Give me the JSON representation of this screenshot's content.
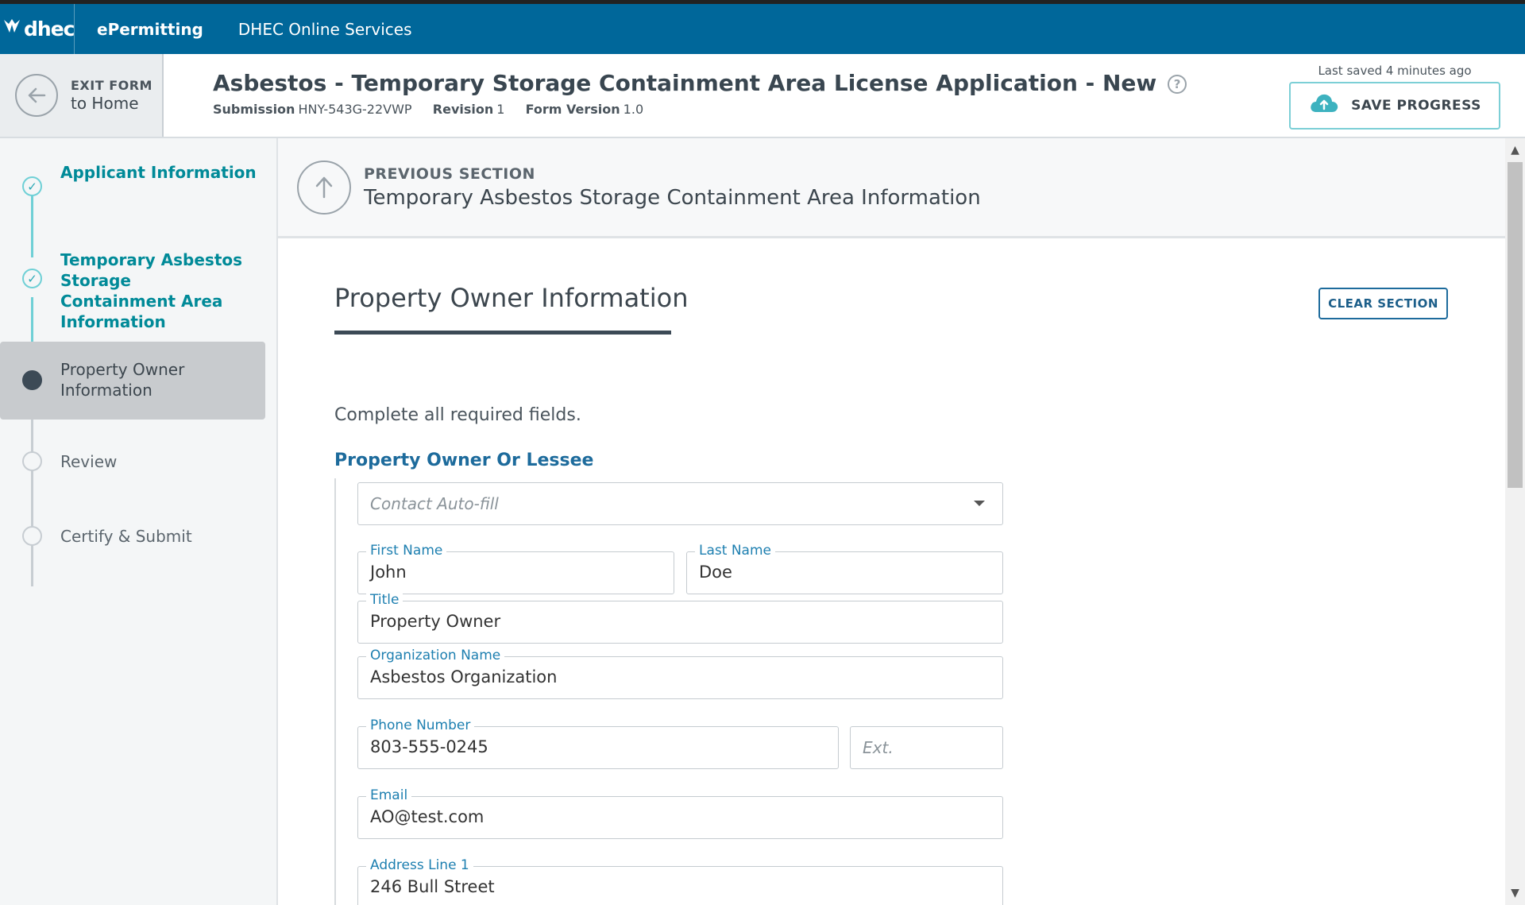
{
  "topbar": {
    "logo_text": "dhec",
    "brand": "ePermitting",
    "services": "DHEC Online Services"
  },
  "header": {
    "exit_line1": "EXIT FORM",
    "exit_line2": "to Home",
    "title": "Asbestos - Temporary Storage Containment Area License Application - New",
    "help_symbol": "?",
    "submission_label": "Submission",
    "submission_value": "HNY-543G-22VWP",
    "revision_label": "Revision",
    "revision_value": "1",
    "version_label": "Form Version",
    "version_value": "1.0",
    "last_saved": "Last saved 4 minutes ago",
    "save_label": "SAVE PROGRESS"
  },
  "sidebar": {
    "steps": [
      {
        "label": "Applicant Information",
        "status": "done"
      },
      {
        "label": "Temporary Asbestos Storage Containment Area Information",
        "status": "done"
      },
      {
        "label": "Property Owner Information",
        "status": "current"
      },
      {
        "label": "Review",
        "status": "todo"
      },
      {
        "label": "Certify & Submit",
        "status": "todo"
      }
    ]
  },
  "main": {
    "prev_section_label": "PREVIOUS SECTION",
    "prev_section_title": "Temporary Asbestos Storage Containment Area Information",
    "section_title": "Property Owner Information",
    "clear_label": "CLEAR SECTION",
    "instructions": "Complete all required fields.",
    "group_title": "Property Owner Or Lessee",
    "autofill_placeholder": "Contact Auto-fill",
    "fields": {
      "first_name": {
        "label": "First Name",
        "value": "John"
      },
      "last_name": {
        "label": "Last Name",
        "value": "Doe"
      },
      "title": {
        "label": "Title",
        "value": "Property Owner"
      },
      "org": {
        "label": "Organization Name",
        "value": "Asbestos Organization"
      },
      "phone": {
        "label": "Phone Number",
        "value": "803-555-0245"
      },
      "ext": {
        "placeholder": "Ext."
      },
      "email": {
        "label": "Email",
        "value": "AO@test.com"
      },
      "address1": {
        "label": "Address Line 1",
        "value": "246 Bull Street"
      }
    }
  },
  "colors": {
    "topbar": "#00679a",
    "accent_teal": "#008a98",
    "link_blue": "#1d6b9c"
  },
  "icons": {
    "exit": "arrow-left-icon",
    "help": "question-circle-icon",
    "save": "cloud-upload-icon",
    "prev": "arrow-up-icon",
    "done": "check-icon",
    "dropdown": "caret-down-icon"
  }
}
